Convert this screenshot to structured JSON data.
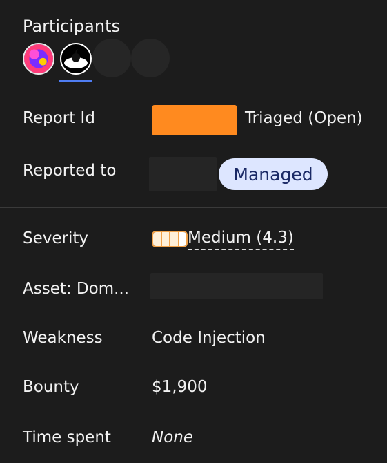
{
  "participants": {
    "title": "Participants",
    "avatars": [
      {
        "name": "tiger-avatar"
      },
      {
        "name": "apple-avatar"
      },
      {
        "name": "empty-avatar"
      },
      {
        "name": "empty-avatar"
      }
    ]
  },
  "report": {
    "id_label": "Report Id",
    "status": "Triaged (Open)",
    "reported_to_label": "Reported to",
    "managed_badge": "Managed"
  },
  "details": {
    "severity_label": "Severity",
    "severity_value": "Medium (4.3)",
    "severity_level_filled": 3,
    "severity_level_total": 4,
    "asset_label": "Asset: Dom...",
    "weakness_label": "Weakness",
    "weakness_value": "Code Injection",
    "bounty_label": "Bounty",
    "bounty_value": "$1,900",
    "time_label": "Time spent",
    "time_value": "None"
  },
  "colors": {
    "background": "#1c1c1c",
    "accent_underline": "#4f7df2",
    "redacted_orange": "#ff8a1f",
    "severity_orange": "#f0a24a",
    "managed_bg": "#dde6ff",
    "managed_text": "#1b2a66"
  }
}
